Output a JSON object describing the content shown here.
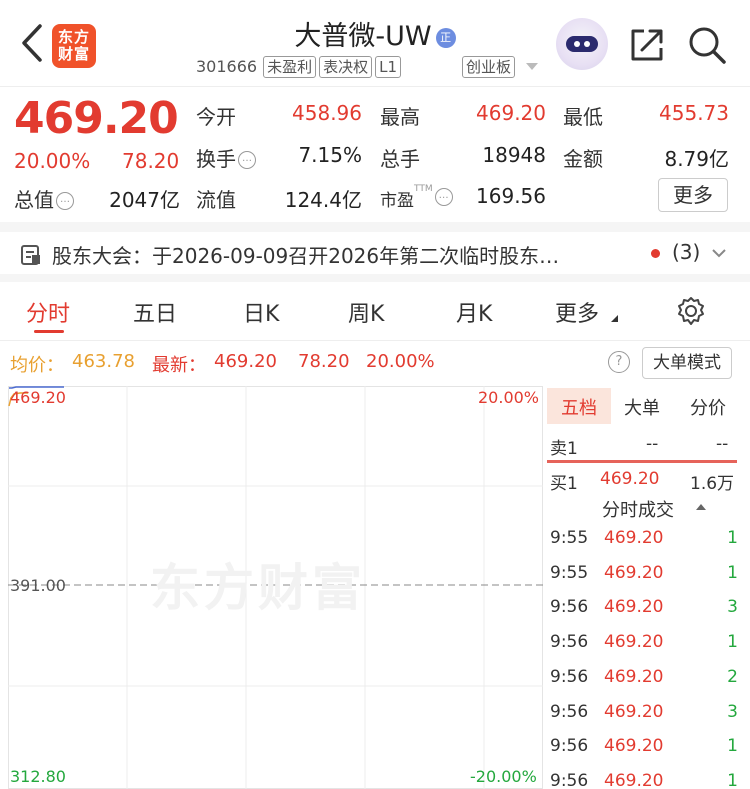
{
  "header": {
    "back_icon": "chevron-left-icon",
    "logo_line1": "东方",
    "logo_line2": "财富",
    "stock_name": "大普微-UW",
    "verify_badge": "正",
    "code": "301666",
    "tags": [
      "未盈利",
      "表决权",
      "L1"
    ],
    "board": "创业板"
  },
  "quote": {
    "price": "469.20",
    "change_pct": "20.00%",
    "change": "78.20",
    "fields": [
      {
        "label": "今开",
        "value": "458.96",
        "color": "red"
      },
      {
        "label": "最高",
        "value": "469.20",
        "color": "red"
      },
      {
        "label": "最低",
        "value": "455.73",
        "color": "red"
      },
      {
        "label": "换手",
        "value": "7.15%",
        "color": "black"
      },
      {
        "label": "总手",
        "value": "18948",
        "color": "black"
      },
      {
        "label": "金额",
        "value": "8.79亿",
        "color": "black"
      },
      {
        "label": "总值",
        "value": "2047亿",
        "color": "black"
      },
      {
        "label": "流值",
        "value": "124.4亿",
        "color": "black"
      },
      {
        "label": "市盈",
        "value": "169.56",
        "color": "black"
      }
    ],
    "pe_sup": "TTM",
    "more_label": "更多"
  },
  "notice": {
    "text": "股东大会：于2026-09-09召开2026年第二次临时股东…",
    "count": "(3)"
  },
  "tabs": [
    "分时",
    "五日",
    "日K",
    "周K",
    "月K",
    "更多"
  ],
  "indicator": {
    "avg_label": "均价：",
    "avg_value": "463.78",
    "latest_label": "最新：",
    "latest_value": "469.20",
    "latest_change": "78.20",
    "latest_pct": "20.00%",
    "help": "?",
    "mode_button": "大单模式"
  },
  "chart": {
    "watermark": "东方财富",
    "top_price": "469.20",
    "top_pct": "20.00%",
    "mid_price": "391.00",
    "bottom_price": "312.80",
    "bottom_pct": "-20.00%"
  },
  "order_book": {
    "tabs": [
      "五档",
      "大单",
      "分价"
    ],
    "sell1": {
      "label": "卖1",
      "price": "--",
      "vol": "--"
    },
    "buy1": {
      "label": "买1",
      "price": "469.20",
      "vol": "1.6万"
    },
    "ticks_title": "分时成交",
    "ticks": [
      {
        "time": "9:55",
        "price": "469.20",
        "vol": "1"
      },
      {
        "time": "9:55",
        "price": "469.20",
        "vol": "1"
      },
      {
        "time": "9:56",
        "price": "469.20",
        "vol": "3"
      },
      {
        "time": "9:56",
        "price": "469.20",
        "vol": "1"
      },
      {
        "time": "9:56",
        "price": "469.20",
        "vol": "2"
      },
      {
        "time": "9:56",
        "price": "469.20",
        "vol": "3"
      },
      {
        "time": "9:56",
        "price": "469.20",
        "vol": "1"
      },
      {
        "time": "9:56",
        "price": "469.20",
        "vol": "1"
      }
    ]
  },
  "colors": {
    "red": "#e23b30",
    "green": "#24a83e",
    "gold": "#e8a030"
  }
}
